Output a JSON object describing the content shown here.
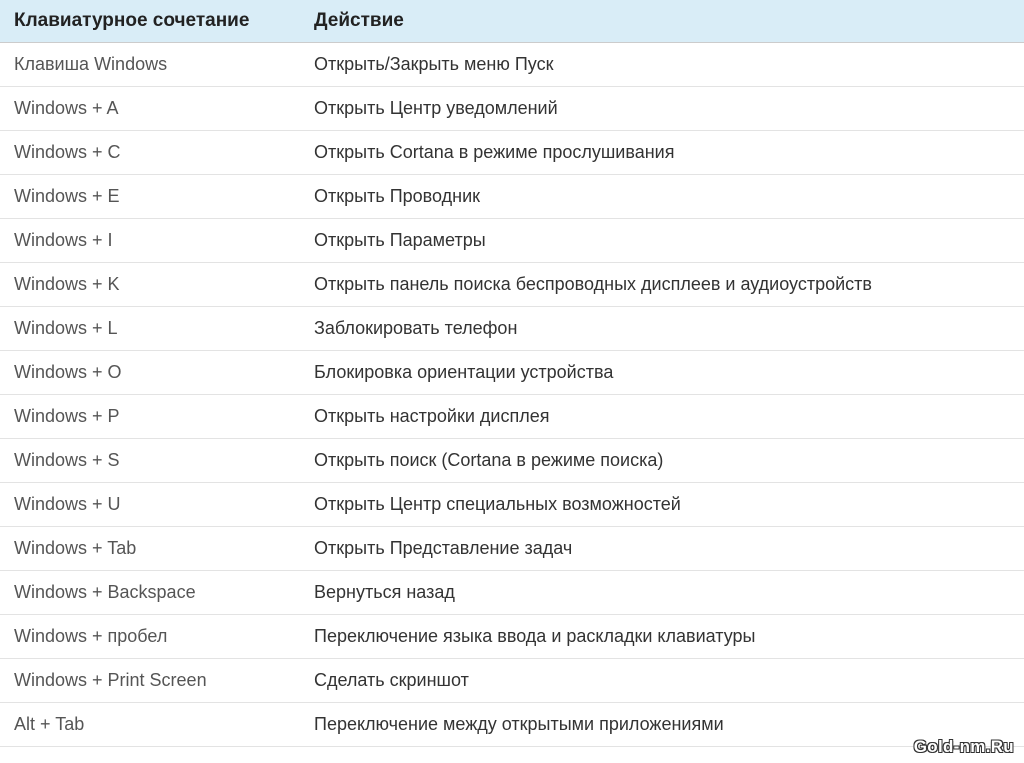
{
  "headers": {
    "shortcut": "Клавиатурное сочетание",
    "action": "Действие"
  },
  "rows": [
    {
      "shortcut": "Клавиша Windows",
      "action": "Открыть/Закрыть меню Пуск"
    },
    {
      "shortcut": "Windows + A",
      "action": "Открыть Центр уведомлений"
    },
    {
      "shortcut": "Windows + C",
      "action": "Открыть Cortana в режиме прослушивания"
    },
    {
      "shortcut": "Windows + E",
      "action": "Открыть Проводник"
    },
    {
      "shortcut": "Windows + I",
      "action": "Открыть Параметры"
    },
    {
      "shortcut": "Windows + K",
      "action": "Открыть панель поиска беспроводных дисплеев и аудиоустройств"
    },
    {
      "shortcut": "Windows + L",
      "action": "Заблокировать телефон"
    },
    {
      "shortcut": "Windows + O",
      "action": "Блокировка ориентации устройства"
    },
    {
      "shortcut": "Windows + P",
      "action": "Открыть настройки дисплея"
    },
    {
      "shortcut": "Windows + S",
      "action": "Открыть поиск (Cortana в режиме поиска)"
    },
    {
      "shortcut": "Windows + U",
      "action": "Открыть Центр специальных возможностей"
    },
    {
      "shortcut": "Windows + Tab",
      "action": "Открыть Представление задач"
    },
    {
      "shortcut": "Windows + Backspace",
      "action": "Вернуться назад"
    },
    {
      "shortcut": "Windows + пробел",
      "action": "Переключение языка ввода и раскладки клавиатуры"
    },
    {
      "shortcut": "Windows + Print Screen",
      "action": "Сделать скриншот"
    },
    {
      "shortcut": "Alt + Tab",
      "action": "Переключение между открытыми приложениями"
    }
  ],
  "watermark": "Gold-nm.Ru"
}
